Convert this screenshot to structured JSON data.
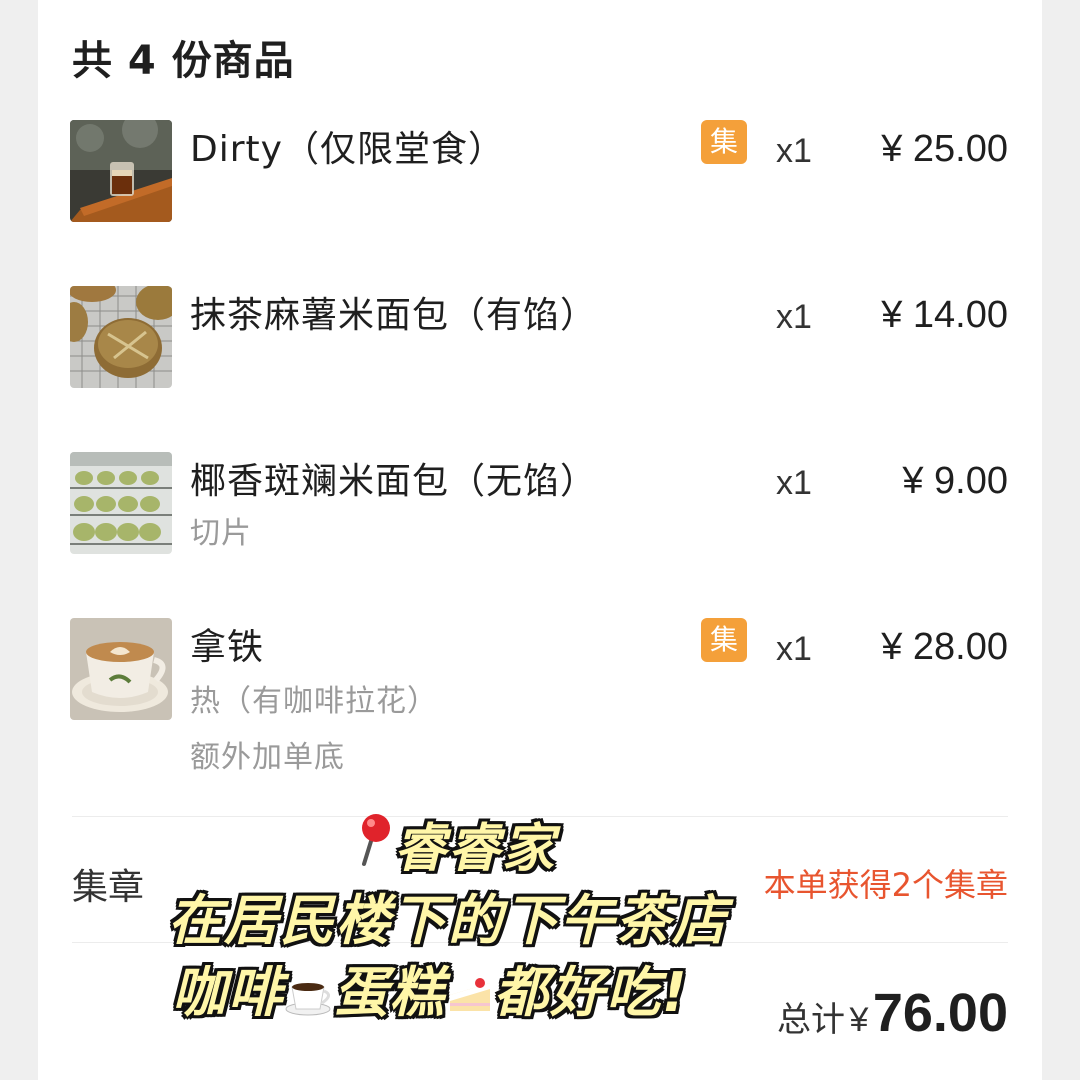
{
  "order": {
    "title": "共 4 份商品",
    "items": [
      {
        "name": "Dirty（仅限堂食）",
        "specs": [],
        "stamp_badge": "集",
        "qty": "x1",
        "price": "¥ 25.00"
      },
      {
        "name": "抹茶麻薯米面包（有馅）",
        "specs": [],
        "stamp_badge": "",
        "qty": "x1",
        "price": "¥ 14.00"
      },
      {
        "name": "椰香斑斓米面包（无馅）",
        "specs": [
          "切片"
        ],
        "stamp_badge": "",
        "qty": "x1",
        "price": "¥ 9.00"
      },
      {
        "name": "拿铁",
        "specs": [
          "热（有咖啡拉花）",
          "额外加单底"
        ],
        "stamp_badge": "集",
        "qty": "x1",
        "price": "¥ 28.00"
      }
    ]
  },
  "stamp": {
    "label": "集章",
    "earned": "本单获得2个集章"
  },
  "total": {
    "label": "总计",
    "currency": "¥",
    "amount": "76.00"
  },
  "caption": {
    "line1": "睿睿家",
    "line2": "在居民楼下的下午茶店",
    "line3_a": "咖啡",
    "line3_b": "蛋糕",
    "line3_c": "都好吃!"
  },
  "colors": {
    "badge": "#f4a03a",
    "stamp_earned": "#e8552f",
    "caption_fill": "#fff6a8"
  },
  "icons": [
    "pin-icon",
    "coffee-cup-icon",
    "cake-slice-icon"
  ]
}
